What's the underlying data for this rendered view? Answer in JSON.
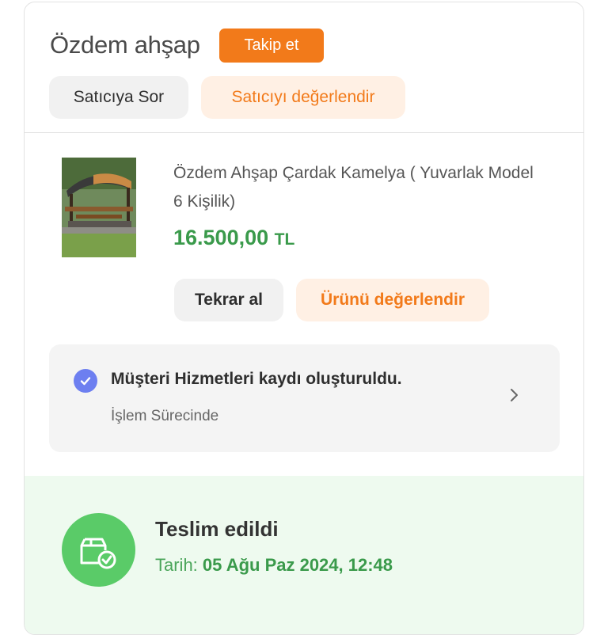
{
  "seller": {
    "name": "Özdem ahşap",
    "follow_label": "Takip et",
    "ask_label": "Satıcıya Sor",
    "rate_label": "Satıcıyı değerlendir"
  },
  "product": {
    "title": "Özdem Ahşap Çardak Kamelya ( Yuvarlak Model 6 Kişilik)",
    "price": "16.500,00",
    "currency": "TL",
    "rebuy_label": "Tekrar al",
    "rate_label": "Ürünü değerlendir"
  },
  "customer_service": {
    "title": "Müşteri Hizmetleri kaydı oluşturuldu.",
    "status": "İşlem Sürecinde"
  },
  "delivery": {
    "title": "Teslim edildi",
    "date_label": "Tarih:",
    "date_value": "05 Ağu Paz 2024, 12:48"
  },
  "colors": {
    "accent": "#f27a1a",
    "accent_soft": "#fff0e4",
    "price_green": "#3a9a4b",
    "check_blue": "#6d7ff0",
    "delivery_bg": "#eefaef",
    "delivery_icon": "#5acb68"
  },
  "icons": {
    "check": "check-circle-icon",
    "chevron": "chevron-right-icon",
    "delivered": "package-delivered-icon"
  }
}
